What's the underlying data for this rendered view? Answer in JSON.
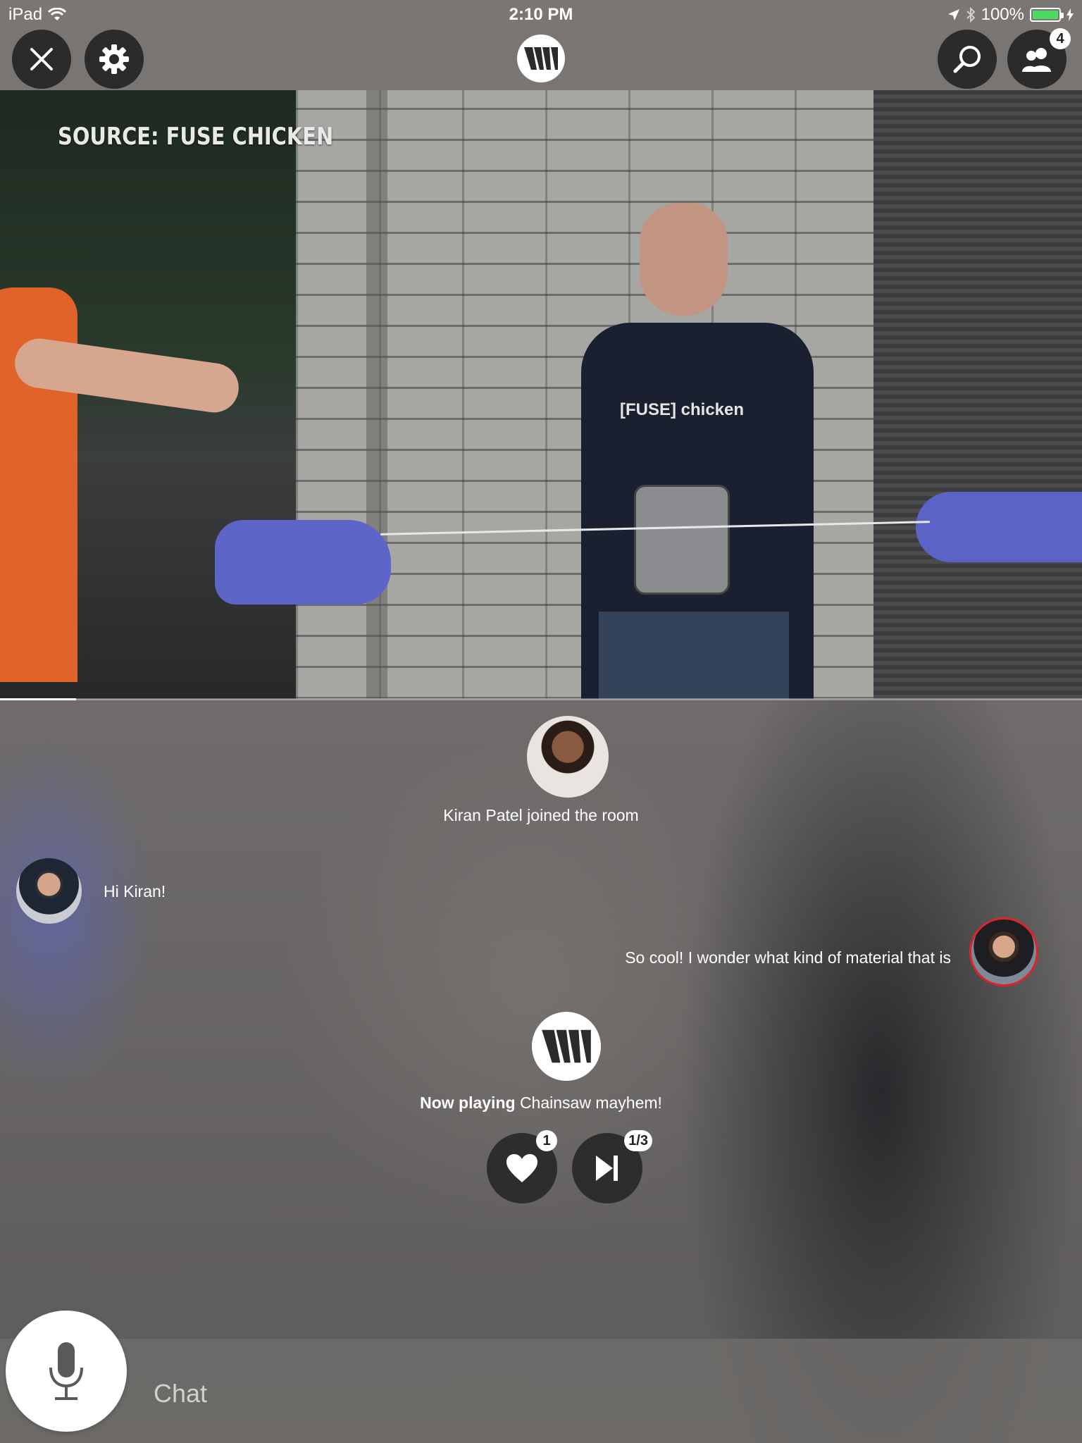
{
  "status_bar": {
    "device": "iPad",
    "time": "2:10 PM",
    "battery": "100%"
  },
  "top_bar": {
    "participants_count": "4",
    "logo_letters": "VM"
  },
  "video": {
    "source_label": "SOURCE: FUSE CHICKEN",
    "shirt_text": "[FUSE] chicken",
    "progress": 0.07
  },
  "chat": {
    "join_message": "Kiran Patel joined the room",
    "messages": [
      {
        "text": "Hi Kiran!",
        "side": "left"
      },
      {
        "text": "So cool! I wonder what kind of material that is",
        "side": "right"
      }
    ],
    "now_playing_label": "Now playing",
    "now_playing_title": "Chainsaw mayhem!"
  },
  "controls": {
    "like_count": "1",
    "skip_count": "1/3"
  },
  "chat_input": {
    "placeholder": "Chat"
  },
  "colors": {
    "button_dark": "#2b2b2b",
    "battery_green": "#4cd964",
    "own_avatar_ring": "#e0232b",
    "glove_blue": "#5d66c8"
  }
}
